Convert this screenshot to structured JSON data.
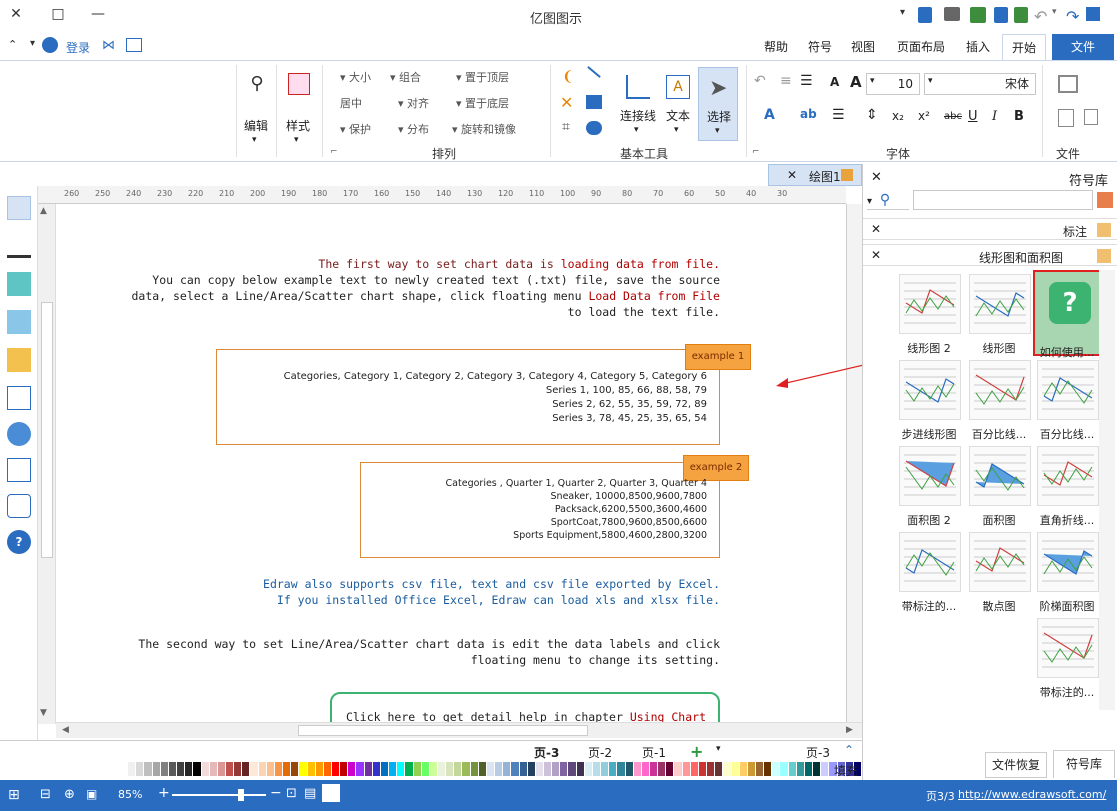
{
  "window": {
    "title": "亿图图示",
    "minimize": "—",
    "maximize": "□",
    "close": "✕"
  },
  "tabs": [
    {
      "label": "文件"
    },
    {
      "label": "开始"
    },
    {
      "label": "插入"
    },
    {
      "label": "页面布局"
    },
    {
      "label": "视图"
    },
    {
      "label": "符号"
    },
    {
      "label": "帮助"
    }
  ],
  "topright": {
    "login": "登录"
  },
  "ribbon": {
    "file_group": "文件",
    "font_group": "字体",
    "font_name": "宋体",
    "font_size": "10",
    "basic_tools_group": "基本工具",
    "select_label": "选择",
    "text_label": "文本",
    "connector_label": "连接线",
    "arrange_group": "排列",
    "bring_front": "置于顶层",
    "send_back": "置于底层",
    "rotate_mirror": "旋转和镜像",
    "group": "组合",
    "align": "对齐",
    "distribute": "分布",
    "size": "大小",
    "center": "居中",
    "protect": "保护",
    "style_label": "样式",
    "edit_label": "编辑"
  },
  "library": {
    "title": "符号库",
    "search_placeholder": "",
    "section_annot": "标注",
    "section_charts": "线形图和面积图",
    "shapes": [
      {
        "label": "如何使用..."
      },
      {
        "label": "线形图"
      },
      {
        "label": "线形图 2"
      },
      {
        "label": "百分比线..."
      },
      {
        "label": "百分比线..."
      },
      {
        "label": "步进线形图"
      },
      {
        "label": "直角折线..."
      },
      {
        "label": "面积图"
      },
      {
        "label": "面积图 2"
      },
      {
        "label": "阶梯面积图"
      },
      {
        "label": "散点图"
      },
      {
        "label": "带标注的..."
      },
      {
        "label": "带标注的..."
      }
    ],
    "bottom_tabs": [
      {
        "label": "符号库"
      },
      {
        "label": "文件恢复"
      }
    ]
  },
  "canvas": {
    "doc_tab": "绘图1",
    "para1": [
      {
        "segments": [
          {
            "t": "The first way to set chart data is ",
            "c": "#7a1c1c"
          },
          {
            "t": "loading data from file.",
            "c": "#b00000"
          }
        ]
      },
      {
        "segments": [
          {
            "t": "You can copy below example text to newly created text (.txt) file, save the source",
            "c": "#222"
          }
        ]
      },
      {
        "segments": [
          {
            "t": "data, select a Line/Area/Scatter chart shape, click floating menu ",
            "c": "#222"
          },
          {
            "t": "Load Data from File",
            "c": "#b00000"
          }
        ]
      },
      {
        "segments": [
          {
            "t": "to load the text file.",
            "c": "#222"
          }
        ]
      }
    ],
    "example1": {
      "badge": "example 1",
      "lines": [
        "Categories, Category 1, Category 2, Category 3, Category 4, Category 5, Category 6",
        "Series 1, 100, 85, 66, 88, 58, 79",
        "Series 2, 62, 55, 35, 59, 72, 89",
        "Series 3, 78, 45, 25, 35, 65, 54"
      ]
    },
    "example2": {
      "badge": "example 2",
      "lines": [
        "Categories , Quarter 1, Quarter 2, Quarter 3, Quarter 4",
        "Sneaker, 10000,8500,9600,7800",
        "Packsack,6200,5500,3600,4600",
        "SportCoat,7800,9600,8500,6600",
        "Sports Equipment,5800,4600,2800,3200"
      ]
    },
    "para2": [
      "Edraw also supports csv file, text and csv file exported by Excel.",
      "If you installed Office Excel, Edraw can load xls and xlsx file."
    ],
    "para3": [
      "The second way to set Line/Area/Scatter chart data is edit the data labels and click",
      "floating menu to change its setting."
    ],
    "para4_plain": "Click here to get detail help in chapter ",
    "para4_link": "Using Chart",
    "ruler_labels": [
      "260",
      "250",
      "240",
      "230",
      "220",
      "210",
      "200",
      "190",
      "180",
      "170",
      "160",
      "150",
      "140",
      "130",
      "120",
      "110",
      "100",
      "90",
      "80",
      "70",
      "60",
      "50",
      "40",
      "30"
    ]
  },
  "pagetabs": [
    {
      "label": "页-3"
    },
    {
      "label": "页-2"
    },
    {
      "label": "页-1"
    },
    {
      "label": "页-3"
    }
  ],
  "palette_label": "填充",
  "status": {
    "url": "http://www.edrawsoft.com/",
    "page": "页3/3",
    "zoom": "85%"
  },
  "colors": {
    "accent": "#2a6cbf",
    "orange_badge": "#f4a340",
    "red_highlight": "#e02020"
  }
}
